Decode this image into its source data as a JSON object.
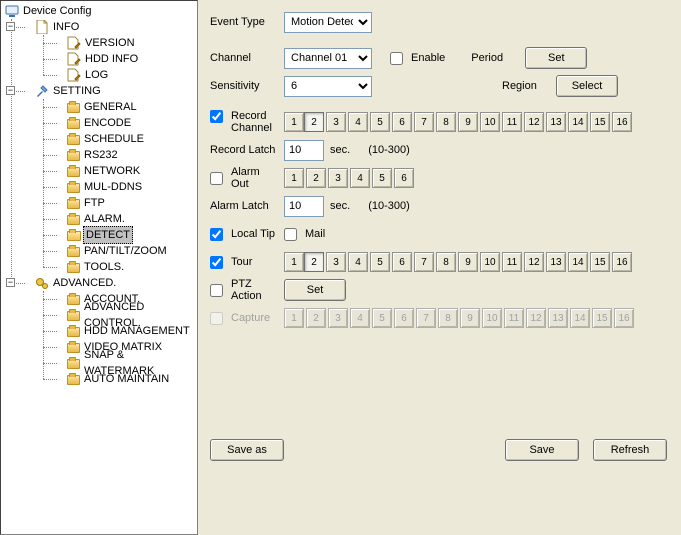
{
  "tree": {
    "root": "Device Config",
    "info": {
      "label": "INFO",
      "items": [
        "VERSION",
        "HDD INFO",
        "LOG"
      ]
    },
    "setting": {
      "label": "SETTING",
      "items": [
        "GENERAL",
        "ENCODE",
        "SCHEDULE",
        "RS232",
        "NETWORK",
        "MUL-DDNS",
        "FTP",
        "ALARM.",
        "DETECT",
        "PAN/TILT/ZOOM",
        "TOOLS."
      ]
    },
    "advanced": {
      "label": "ADVANCED.",
      "items": [
        "ACCOUNT.",
        "ADVANCED CONTROL.",
        "HDD MANAGEMENT",
        "VIDEO MATRIX",
        "SNAP & WATERMARK",
        "AUTO MAINTAIN"
      ]
    },
    "selected": "DETECT"
  },
  "labels": {
    "event_type": "Event Type",
    "channel": "Channel",
    "sensitivity": "Sensitivity",
    "enable": "Enable",
    "period": "Period",
    "region": "Region",
    "record_channel": "Record Channel",
    "record_latch": "Record Latch",
    "alarm_out": "Alarm Out",
    "alarm_latch": "Alarm Latch",
    "local_tip": "Local Tip",
    "mail": "Mail",
    "tour": "Tour",
    "ptz_action": "PTZ Action",
    "capture": "Capture",
    "sec": "sec.",
    "latch_range": "(10-300)"
  },
  "buttons": {
    "set": "Set",
    "select": "Select",
    "save_as": "Save as",
    "save": "Save",
    "refresh": "Refresh"
  },
  "values": {
    "event_type": "Motion Detec",
    "channel": "Channel  01",
    "sensitivity": "6",
    "record_latch": "10",
    "alarm_latch": "10",
    "enable": false,
    "record_channel_chk": true,
    "alarm_out_chk": false,
    "local_tip_chk": true,
    "mail_chk": false,
    "tour_chk": true,
    "ptz_action_chk": false,
    "capture_chk": false
  },
  "channels16": [
    "1",
    "2",
    "3",
    "4",
    "5",
    "6",
    "7",
    "8",
    "9",
    "10",
    "11",
    "12",
    "13",
    "14",
    "15",
    "16"
  ],
  "channels6": [
    "1",
    "2",
    "3",
    "4",
    "5",
    "6"
  ],
  "record_selected": "2",
  "tour_selected": "2"
}
